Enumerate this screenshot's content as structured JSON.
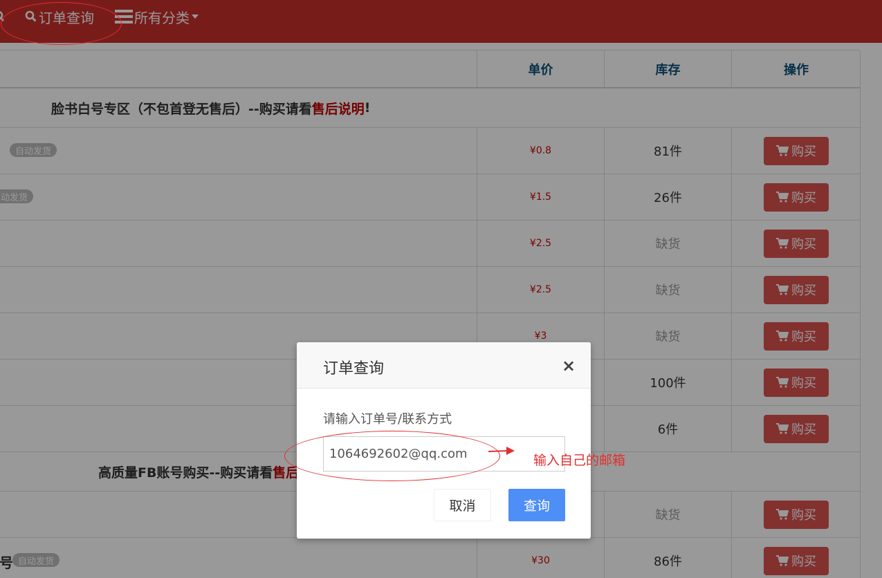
{
  "nav": {
    "order_query": "订单查询",
    "all_categories": "所有分类"
  },
  "table": {
    "headers": {
      "price": "单价",
      "stock": "库存",
      "action": "操作"
    },
    "group1": {
      "title_main": "脸书白号专区（不包首登无售后）--购买请看",
      "title_red": "售后说明",
      "title_tail": "!"
    },
    "group2": {
      "title_main": "高质量FB账号购买--购买请看",
      "title_red": "售后"
    },
    "badge": "自动发货",
    "badge_partial": "动发货",
    "row_last_text": "号",
    "buy_label": "购买",
    "rows": [
      {
        "price": "¥0.8",
        "stock": "81件"
      },
      {
        "price": "¥1.5",
        "stock": "26件"
      },
      {
        "price": "¥2.5",
        "stock": "缺货"
      },
      {
        "price": "¥2.5",
        "stock": "缺货"
      },
      {
        "price": "¥3",
        "stock": "缺货"
      },
      {
        "price": "",
        "stock": "100件"
      },
      {
        "price": "",
        "stock": "6件"
      }
    ],
    "rows2": [
      {
        "price": "",
        "stock": "缺货"
      },
      {
        "price": "¥30",
        "stock": "86件"
      }
    ]
  },
  "modal": {
    "title": "订单查询",
    "close": "×",
    "label": "请输入订单号/联系方式",
    "input_value": "1064692602@qq.com",
    "cancel": "取消",
    "query": "查询"
  },
  "annotation": {
    "text": "输入自己的邮箱",
    "color": "#e03030"
  }
}
